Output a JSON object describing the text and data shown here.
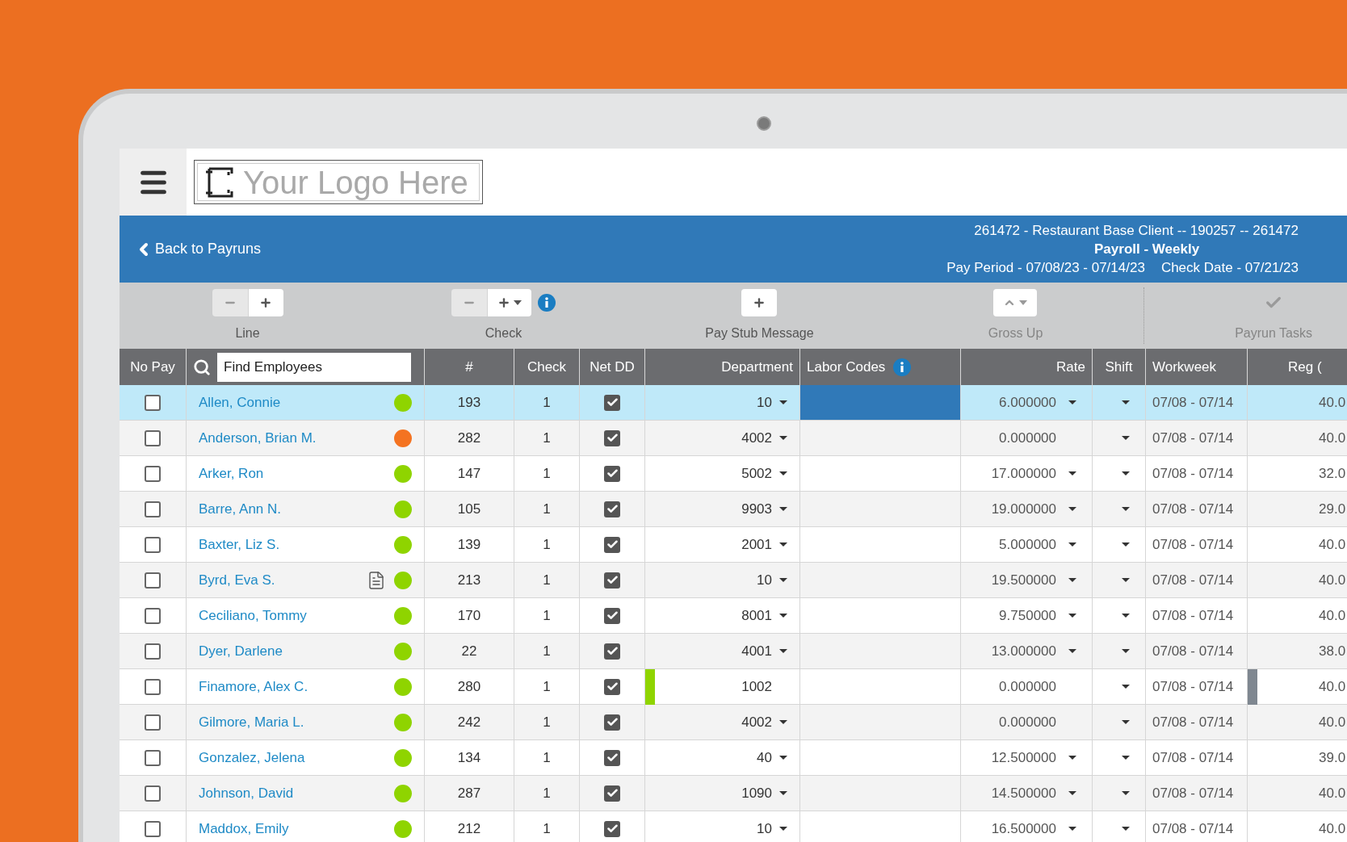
{
  "logo": {
    "text": "Your Logo Here"
  },
  "header": {
    "back_link": "Back to Payruns",
    "client": "261472 - Restaurant Base Client -- 190257 -- 261472",
    "payroll": "Payroll - Weekly",
    "pay_period": "Pay Period - 07/08/23 - 07/14/23",
    "check_date": "Check Date - 07/21/23"
  },
  "toolbar": [
    {
      "label": "Line",
      "disabled": false,
      "info": false,
      "buttons": [
        {
          "kind": "minus",
          "disabled": true
        },
        {
          "kind": "plus",
          "disabled": false
        }
      ]
    },
    {
      "label": "Check",
      "disabled": false,
      "info": true,
      "buttons": [
        {
          "kind": "minus",
          "disabled": true
        },
        {
          "kind": "plus_menu",
          "disabled": false
        }
      ]
    },
    {
      "label": "Pay Stub Message",
      "disabled": false,
      "info": false,
      "buttons": [
        {
          "kind": "plus",
          "disabled": false
        }
      ]
    },
    {
      "label": "Gross Up",
      "disabled": true,
      "info": false,
      "buttons": [
        {
          "kind": "up_menu",
          "disabled": true
        }
      ]
    },
    {
      "label": "Payrun Tasks",
      "disabled": true,
      "info": false,
      "buttons": [
        {
          "kind": "check",
          "disabled": true
        }
      ]
    }
  ],
  "columns": [
    {
      "kind": "text",
      "label": "No Pay"
    },
    {
      "kind": "search",
      "placeholder": "Find Employees"
    },
    {
      "kind": "text",
      "label": "#"
    },
    {
      "kind": "text",
      "label": "Check"
    },
    {
      "kind": "text",
      "label": "Net DD"
    },
    {
      "kind": "text",
      "label": "Department"
    },
    {
      "kind": "info",
      "label": "Labor Codes"
    },
    {
      "kind": "text",
      "label": "Rate"
    },
    {
      "kind": "text",
      "label": "Shift"
    },
    {
      "kind": "text",
      "label": "Workweek"
    },
    {
      "kind": "text",
      "label": "Reg ("
    }
  ],
  "rows": [
    {
      "selected": true,
      "no_pay": false,
      "name": "Allen, Connie",
      "note": false,
      "color": "#8fd400",
      "number": "193",
      "check": "1",
      "net_dd": true,
      "department": "10",
      "department_dropdown": true,
      "department_flagged": false,
      "labor_selected": true,
      "rate": "6.000000",
      "rate_dropdown": true,
      "workweek": "07/08 - 07/14",
      "reg": "40.0",
      "reg_flagged": false
    },
    {
      "selected": false,
      "no_pay": false,
      "name": "Anderson, Brian M.",
      "note": false,
      "color": "#f47321",
      "number": "282",
      "check": "1",
      "net_dd": true,
      "department": "4002",
      "department_dropdown": true,
      "department_flagged": false,
      "labor_selected": false,
      "rate": "0.000000",
      "rate_dropdown": false,
      "workweek": "07/08 - 07/14",
      "reg": "40.0",
      "reg_flagged": false
    },
    {
      "selected": false,
      "no_pay": false,
      "name": "Arker, Ron",
      "note": false,
      "color": "#8fd400",
      "number": "147",
      "check": "1",
      "net_dd": true,
      "department": "5002",
      "department_dropdown": true,
      "department_flagged": false,
      "labor_selected": false,
      "rate": "17.000000",
      "rate_dropdown": true,
      "workweek": "07/08 - 07/14",
      "reg": "32.0",
      "reg_flagged": false
    },
    {
      "selected": false,
      "no_pay": false,
      "name": "Barre, Ann N.",
      "note": false,
      "color": "#8fd400",
      "number": "105",
      "check": "1",
      "net_dd": true,
      "department": "9903",
      "department_dropdown": true,
      "department_flagged": false,
      "labor_selected": false,
      "rate": "19.000000",
      "rate_dropdown": true,
      "workweek": "07/08 - 07/14",
      "reg": "29.0",
      "reg_flagged": false
    },
    {
      "selected": false,
      "no_pay": false,
      "name": "Baxter, Liz S.",
      "note": false,
      "color": "#8fd400",
      "number": "139",
      "check": "1",
      "net_dd": true,
      "department": "2001",
      "department_dropdown": true,
      "department_flagged": false,
      "labor_selected": false,
      "rate": "5.000000",
      "rate_dropdown": true,
      "workweek": "07/08 - 07/14",
      "reg": "40.0",
      "reg_flagged": false
    },
    {
      "selected": false,
      "no_pay": false,
      "name": "Byrd, Eva S.",
      "note": true,
      "color": "#8fd400",
      "number": "213",
      "check": "1",
      "net_dd": true,
      "department": "10",
      "department_dropdown": true,
      "department_flagged": false,
      "labor_selected": false,
      "rate": "19.500000",
      "rate_dropdown": true,
      "workweek": "07/08 - 07/14",
      "reg": "40.0",
      "reg_flagged": false
    },
    {
      "selected": false,
      "no_pay": false,
      "name": "Ceciliano, Tommy",
      "note": false,
      "color": "#8fd400",
      "number": "170",
      "check": "1",
      "net_dd": true,
      "department": "8001",
      "department_dropdown": true,
      "department_flagged": false,
      "labor_selected": false,
      "rate": "9.750000",
      "rate_dropdown": true,
      "workweek": "07/08 - 07/14",
      "reg": "40.0",
      "reg_flagged": false
    },
    {
      "selected": false,
      "no_pay": false,
      "name": "Dyer, Darlene",
      "note": false,
      "color": "#8fd400",
      "number": "22",
      "check": "1",
      "net_dd": true,
      "department": "4001",
      "department_dropdown": true,
      "department_flagged": false,
      "labor_selected": false,
      "rate": "13.000000",
      "rate_dropdown": true,
      "workweek": "07/08 - 07/14",
      "reg": "38.0",
      "reg_flagged": false
    },
    {
      "selected": false,
      "no_pay": false,
      "name": "Finamore, Alex C.",
      "note": false,
      "color": "#8fd400",
      "number": "280",
      "check": "1",
      "net_dd": true,
      "department": "1002",
      "department_dropdown": false,
      "department_flagged": true,
      "labor_selected": false,
      "rate": "0.000000",
      "rate_dropdown": false,
      "workweek": "07/08 - 07/14",
      "reg": "40.0",
      "reg_flagged": true
    },
    {
      "selected": false,
      "no_pay": false,
      "name": "Gilmore, Maria L.",
      "note": false,
      "color": "#8fd400",
      "number": "242",
      "check": "1",
      "net_dd": true,
      "department": "4002",
      "department_dropdown": true,
      "department_flagged": false,
      "labor_selected": false,
      "rate": "0.000000",
      "rate_dropdown": false,
      "workweek": "07/08 - 07/14",
      "reg": "40.0",
      "reg_flagged": false
    },
    {
      "selected": false,
      "no_pay": false,
      "name": "Gonzalez, Jelena",
      "note": false,
      "color": "#8fd400",
      "number": "134",
      "check": "1",
      "net_dd": true,
      "department": "40",
      "department_dropdown": true,
      "department_flagged": false,
      "labor_selected": false,
      "rate": "12.500000",
      "rate_dropdown": true,
      "workweek": "07/08 - 07/14",
      "reg": "39.0",
      "reg_flagged": false
    },
    {
      "selected": false,
      "no_pay": false,
      "name": "Johnson, David",
      "note": false,
      "color": "#8fd400",
      "number": "287",
      "check": "1",
      "net_dd": true,
      "department": "1090",
      "department_dropdown": true,
      "department_flagged": false,
      "labor_selected": false,
      "rate": "14.500000",
      "rate_dropdown": true,
      "workweek": "07/08 - 07/14",
      "reg": "40.0",
      "reg_flagged": false
    },
    {
      "selected": false,
      "no_pay": false,
      "name": "Maddox, Emily",
      "note": false,
      "color": "#8fd400",
      "number": "212",
      "check": "1",
      "net_dd": true,
      "department": "10",
      "department_dropdown": true,
      "department_flagged": false,
      "labor_selected": false,
      "rate": "16.500000",
      "rate_dropdown": true,
      "workweek": "07/08 - 07/14",
      "reg": "40.0",
      "reg_flagged": false
    }
  ]
}
